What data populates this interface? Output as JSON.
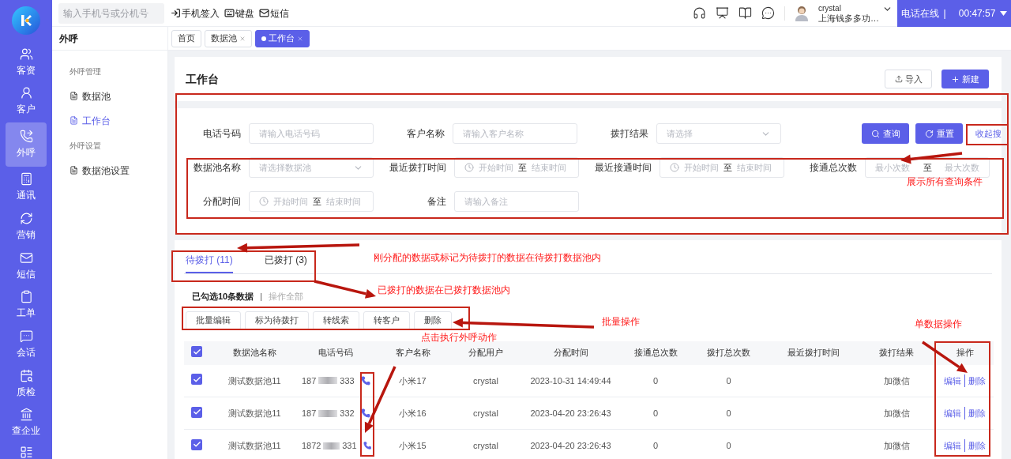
{
  "sidebar": {
    "nav": [
      {
        "label": "客资",
        "selected": false
      },
      {
        "label": "客户",
        "selected": false
      },
      {
        "label": "外呼",
        "selected": true
      },
      {
        "label": "通讯",
        "selected": false
      },
      {
        "label": "营销",
        "selected": false
      },
      {
        "label": "短信",
        "selected": false
      },
      {
        "label": "工单",
        "selected": false
      },
      {
        "label": "会话",
        "selected": false
      },
      {
        "label": "质检",
        "selected": false
      },
      {
        "label": "查企业",
        "selected": false
      }
    ]
  },
  "topbar": {
    "search": {
      "placeholder": "输入手机号或分机号"
    },
    "actions": [
      "手机签入",
      "键盘",
      "短信"
    ],
    "user": {
      "name": "crystal",
      "company": "上海钱多多功…"
    },
    "phone_status": {
      "status": "电话在线",
      "separator": "|",
      "timer": "00:47:57"
    }
  },
  "section_title": "外呼",
  "page_tabs": [
    {
      "label": "首页",
      "closable": false,
      "selected": false
    },
    {
      "label": "数据池",
      "closable": true,
      "selected": false
    },
    {
      "label": "工作台",
      "closable": true,
      "selected": true
    }
  ],
  "submenu": [
    {
      "kind": "group",
      "label": "外呼管理"
    },
    {
      "kind": "item",
      "label": "数据池",
      "selected": false
    },
    {
      "kind": "item",
      "label": "工作台",
      "selected": true
    },
    {
      "kind": "group",
      "label": "外呼设置"
    },
    {
      "kind": "item",
      "label": "数据池设置",
      "selected": false
    }
  ],
  "card": {
    "title": "工作台",
    "buttons": [
      {
        "label": "导入",
        "kind": "secondary"
      },
      {
        "label": "新建",
        "kind": "primary"
      }
    ]
  },
  "filter_rows": [
    {
      "fields": [
        {
          "kind": "text",
          "label": "电话号码",
          "placeholder": "请输入电话号码"
        },
        {
          "kind": "text",
          "label": "客户名称",
          "placeholder": "请输入客户名称"
        },
        {
          "kind": "select",
          "label": "拨打结果",
          "placeholder": "请选择"
        }
      ]
    },
    {
      "fields": [
        {
          "kind": "select",
          "label": "数据池名称",
          "placeholder": "请选择数据池"
        },
        {
          "kind": "daterange",
          "label": "最近拨打时间",
          "start": "开始时间",
          "to": "至",
          "end": "结束时间"
        },
        {
          "kind": "daterange",
          "label": "最近接通时间",
          "start": "开始时间",
          "to": "至",
          "end": "结束时间"
        },
        {
          "kind": "range",
          "label": "接通总次数",
          "start": "最小次数",
          "to": "至",
          "end": "最大次数"
        }
      ]
    },
    {
      "fields": [
        {
          "kind": "daterange",
          "label": "分配时间",
          "start": "开始时间",
          "to": "至",
          "end": "结束时间"
        },
        {
          "kind": "text",
          "label": "备注",
          "placeholder": "请输入备注"
        }
      ]
    }
  ],
  "filter_buttons": [
    {
      "label": "查询",
      "kind": "search"
    },
    {
      "label": "重置",
      "kind": "reset"
    },
    {
      "label": "收起搜",
      "kind": "link"
    }
  ],
  "list_tabs": [
    {
      "label": "待拨打 (11)",
      "selected": true
    },
    {
      "label": "已拨打 (3)",
      "selected": false
    }
  ],
  "selection": {
    "summary": "已勾选10条数据",
    "separator": "|",
    "select_all": "操作全部"
  },
  "batch_actions": [
    "批量编辑",
    "标为待拨打",
    "转线索",
    "转客户",
    "删除"
  ],
  "table": {
    "all_checked": true,
    "columns": [
      "数据池名称",
      "电话号码",
      "客户名称",
      "分配用户",
      "分配时间",
      "接通总次数",
      "拨打总次数",
      "最近拨打时间",
      "拨打结果",
      "操作"
    ],
    "rows": [
      {
        "checked": true,
        "pool": "测试数据池11",
        "phone_prefix": "187",
        "phone_suffix": "333",
        "customer": "小米17",
        "user": "crystal",
        "assigned_at": "2023-10-31 14:49:44",
        "connected": "0",
        "dialed": "0",
        "result": "加微信",
        "actions": [
          "编辑",
          "删除"
        ]
      },
      {
        "checked": true,
        "pool": "测试数据池11",
        "phone_prefix": "187",
        "phone_suffix": "332",
        "customer": "小米16",
        "user": "crystal",
        "assigned_at": "2023-04-20 23:26:43",
        "connected": "0",
        "dialed": "0",
        "result": "加微信",
        "actions": [
          "编辑",
          "删除"
        ]
      },
      {
        "checked": true,
        "pool": "测试数据池11",
        "phone_prefix": "1872",
        "phone_suffix": "331",
        "customer": "小米15",
        "user": "crystal",
        "assigned_at": "2023-04-20 23:26:43",
        "connected": "0",
        "dialed": "0",
        "result": "加微信",
        "actions": [
          "编辑",
          "删除"
        ]
      }
    ]
  },
  "annotations": [
    "展示所有查询条件",
    "刚分配的数据或标记为待拨打的数据在待拨打数据池内",
    "已拨打的数据在已拨打数据池内",
    "批量操作",
    "单数据操作",
    "点击执行外呼动作"
  ]
}
